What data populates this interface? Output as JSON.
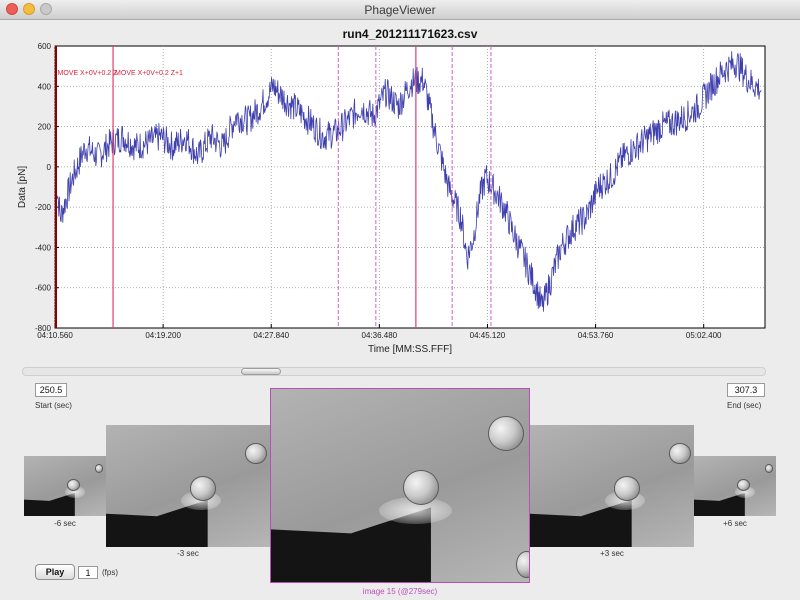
{
  "window": {
    "title": "PhageViewer"
  },
  "chart_data": {
    "type": "line",
    "title": "run4_201211171623.csv",
    "xlabel": "Time [MM:SS.FFF]",
    "ylabel": "Data [pN]",
    "x_ticks": [
      "04:10.560",
      "04:19.200",
      "04:27.840",
      "04:36.480",
      "04:45.120",
      "04:53.760",
      "05:02.400"
    ],
    "x_tick_seconds": [
      250.56,
      259.2,
      267.84,
      276.48,
      285.12,
      293.76,
      302.4
    ],
    "xlim": [
      250.56,
      307.3
    ],
    "y_ticks": [
      "600",
      "400",
      "200",
      "0",
      "-200",
      "-400",
      "-600",
      "-800"
    ],
    "ylim": [
      -800,
      600
    ],
    "grid": true,
    "series": [
      {
        "color": "#3f3fae",
        "points": [
          [
            250.6,
            -50
          ],
          [
            251,
            -250
          ],
          [
            251.5,
            -150
          ],
          [
            252,
            -50
          ],
          [
            253,
            100
          ],
          [
            254,
            50
          ],
          [
            255,
            120
          ],
          [
            256,
            150
          ],
          [
            257,
            100
          ],
          [
            258,
            120
          ],
          [
            259,
            150
          ],
          [
            260,
            100
          ],
          [
            261,
            150
          ],
          [
            262,
            50
          ],
          [
            263,
            150
          ],
          [
            264,
            100
          ],
          [
            265,
            250
          ],
          [
            266,
            230
          ],
          [
            267,
            300
          ],
          [
            268,
            400
          ],
          [
            269,
            330
          ],
          [
            270,
            280
          ],
          [
            271,
            220
          ],
          [
            272,
            150
          ],
          [
            273,
            170
          ],
          [
            274,
            230
          ],
          [
            275,
            300
          ],
          [
            276,
            250
          ],
          [
            277,
            370
          ],
          [
            278,
            300
          ],
          [
            279,
            420
          ],
          [
            280,
            430
          ],
          [
            281,
            150
          ],
          [
            282,
            -100
          ],
          [
            283,
            -250
          ],
          [
            283.5,
            -450
          ],
          [
            284,
            -350
          ],
          [
            284.5,
            -150
          ],
          [
            285,
            -50
          ],
          [
            286,
            -150
          ],
          [
            286.6,
            -220
          ],
          [
            287,
            -300
          ],
          [
            288,
            -450
          ],
          [
            289,
            -600
          ],
          [
            289.5,
            -700
          ],
          [
            290,
            -600
          ],
          [
            291,
            -400
          ],
          [
            292,
            -300
          ],
          [
            293,
            -250
          ],
          [
            294,
            -100
          ],
          [
            295,
            -50
          ],
          [
            296,
            50
          ],
          [
            297,
            100
          ],
          [
            298,
            150
          ],
          [
            299,
            200
          ],
          [
            300,
            220
          ],
          [
            301,
            250
          ],
          [
            302,
            300
          ],
          [
            303,
            400
          ],
          [
            304,
            480
          ],
          [
            305,
            520
          ],
          [
            306,
            430
          ],
          [
            307,
            380
          ]
        ]
      }
    ],
    "markers": {
      "solid_red_s": [
        250.6,
        255.2,
        279.4
      ],
      "dashed_magenta_s": [
        273.2,
        276.2,
        282.3,
        285.4
      ],
      "annotations": [
        "MOVE X+0V+0.2 Z",
        "MOVE X+0V+0.2 Z+1"
      ],
      "colors": {
        "solid": "#e0406c",
        "dashed": "#d060d0",
        "text": "#e02040"
      }
    }
  },
  "slider": {
    "position": 0.31
  },
  "range": {
    "start_value": "250.5",
    "start_label": "Start (sec)",
    "end_value": "307.3",
    "end_label": "End (sec)"
  },
  "frames": {
    "far_left": {
      "caption": "-6 sec"
    },
    "left": {
      "caption": "-3 sec"
    },
    "center": {
      "caption": "image 15 (@279sec)"
    },
    "right": {
      "caption": "+3 sec"
    },
    "far_right": {
      "caption": "+6 sec"
    }
  },
  "playback": {
    "play_label": "Play",
    "fps_value": "1",
    "fps_unit": "(fps)"
  }
}
